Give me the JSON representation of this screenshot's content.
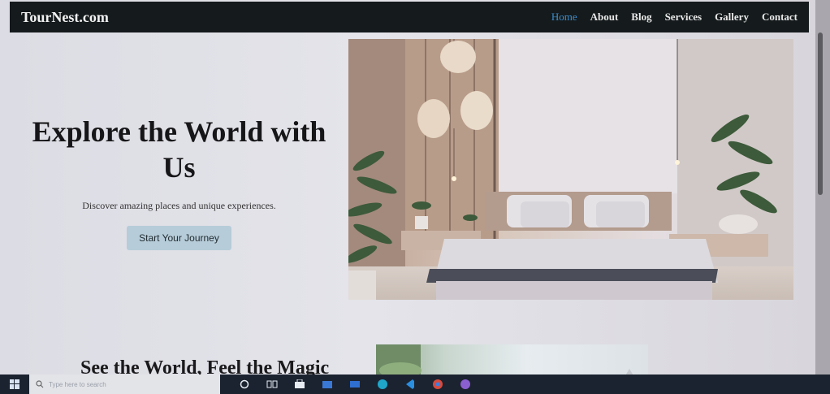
{
  "brand": "TourNest.com",
  "nav": {
    "items": [
      {
        "label": "Home",
        "active": true
      },
      {
        "label": "About"
      },
      {
        "label": "Blog"
      },
      {
        "label": "Services"
      },
      {
        "label": "Gallery"
      },
      {
        "label": "Contact"
      }
    ]
  },
  "hero": {
    "title": "Explore the World with Us",
    "subtitle": "Discover amazing places and unique experiences.",
    "cta": "Start Your Journey"
  },
  "section2": {
    "title": "See the World, Feel the Magic"
  },
  "taskbar": {
    "search_placeholder": "Type here to search",
    "icons": [
      "search-icon",
      "task-view-icon",
      "store-icon",
      "file-explorer-icon",
      "mail-icon",
      "edge-icon",
      "vscode-icon",
      "chrome-icon",
      "app-icon"
    ]
  },
  "colors": {
    "nav_bg": "#151a1c",
    "nav_active": "#3b8fd0",
    "cta_bg": "#b6ccd8",
    "taskbar_bg": "#1c2330"
  }
}
